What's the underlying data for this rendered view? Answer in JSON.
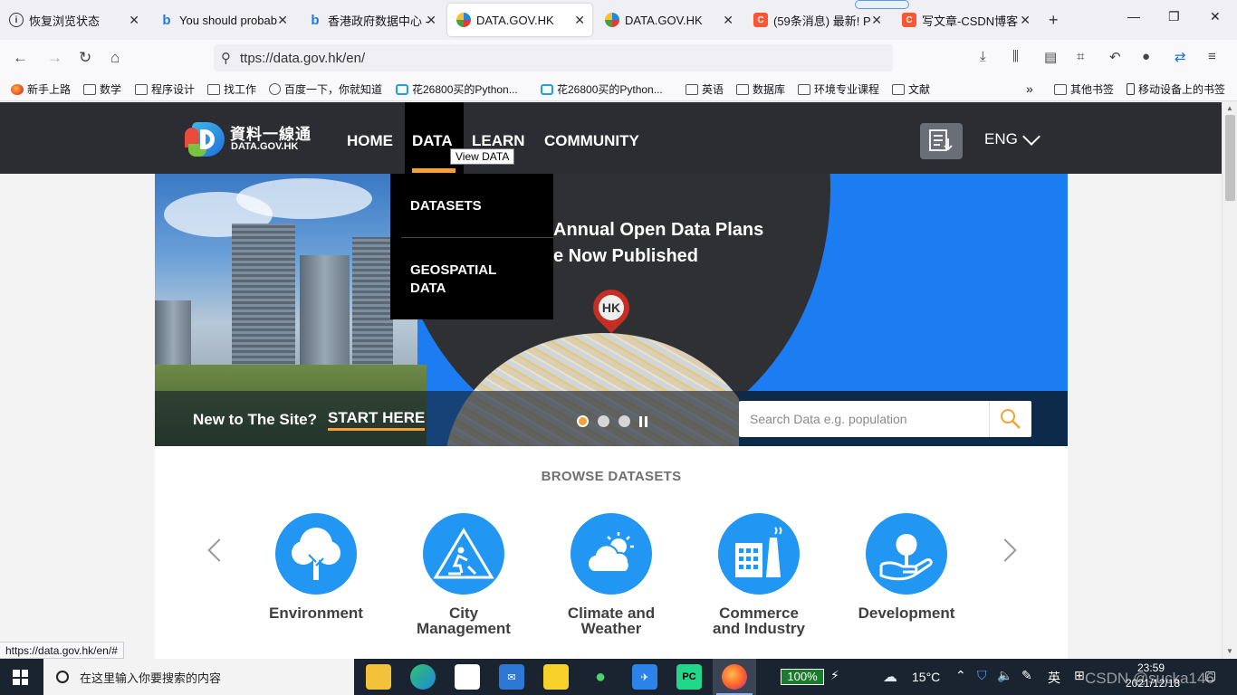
{
  "browser": {
    "tabs": [
      {
        "label": "恢复浏览状态",
        "favicon": "info-icon",
        "active": false
      },
      {
        "label": "You should probab",
        "favicon": "bing-icon",
        "active": false
      },
      {
        "label": "香港政府数据中心 -",
        "favicon": "bing-icon",
        "active": false
      },
      {
        "label": "DATA.GOV.HK",
        "favicon": "datagovhk-icon",
        "active": true
      },
      {
        "label": "DATA.GOV.HK",
        "favicon": "datagovhk-icon",
        "active": false
      },
      {
        "label": "(59条消息) 最新! P",
        "favicon": "csdn-icon",
        "active": false
      },
      {
        "label": "写文章-CSDN博客",
        "favicon": "csdn-icon",
        "active": false
      }
    ],
    "url": "ttps://data.gov.hk/en/",
    "bookmarks": [
      "新手上路",
      "数学",
      "程序设计",
      "找工作",
      "百度一下，你就知道",
      "花26800买的Python...",
      "花26800买的Python...",
      "英语",
      "数据库",
      "环境专业课程",
      "文献",
      "其他书签",
      "移动设备上的书签"
    ],
    "status_url": "https://data.gov.hk/en/#"
  },
  "site": {
    "logo_cn": "資料一線通",
    "logo_en": "DATA.GOV.HK",
    "menu": {
      "home": "HOME",
      "data": "DATA",
      "learn": "LEARN",
      "community": "COMMUNITY"
    },
    "tooltip": "View DATA",
    "language": "ENG",
    "dropdown": {
      "datasets": "DATASETS",
      "geospatial_line1": "GEOSPATIAL",
      "geospatial_line2": "DATA"
    },
    "hero": {
      "headline_line1": "Annual Open Data Plans",
      "headline_line2": "e Now Published",
      "pin_label": "HK",
      "new_to_site": "New to The Site?",
      "start_here": "START HERE",
      "search_placeholder": "Search Data e.g. population",
      "slides": 3,
      "active_slide": 1
    },
    "browse": {
      "title": "BROWSE DATASETS",
      "categories": [
        {
          "line1": "Environment",
          "line2": "",
          "icon": "tree-icon"
        },
        {
          "line1": "City",
          "line2": "Management",
          "icon": "construction-sign-icon"
        },
        {
          "line1": "Climate and",
          "line2": "Weather",
          "icon": "cloud-sun-icon"
        },
        {
          "line1": "Commerce",
          "line2": "and Industry",
          "icon": "factory-icon"
        },
        {
          "line1": "Development",
          "line2": "",
          "icon": "plant-in-hand-icon"
        }
      ]
    }
  },
  "taskbar": {
    "search_placeholder": "在这里输入你要搜索的内容",
    "battery": "100%",
    "temperature": "15°C",
    "ime": "英",
    "time": "23:59",
    "date": "2021/12/18",
    "watermark": "CSDN @sucka146"
  },
  "colors": {
    "accent": "#f7a033",
    "header": "#2b2d33",
    "category": "#2196f3",
    "hero_blue": "#1c7cf2"
  }
}
